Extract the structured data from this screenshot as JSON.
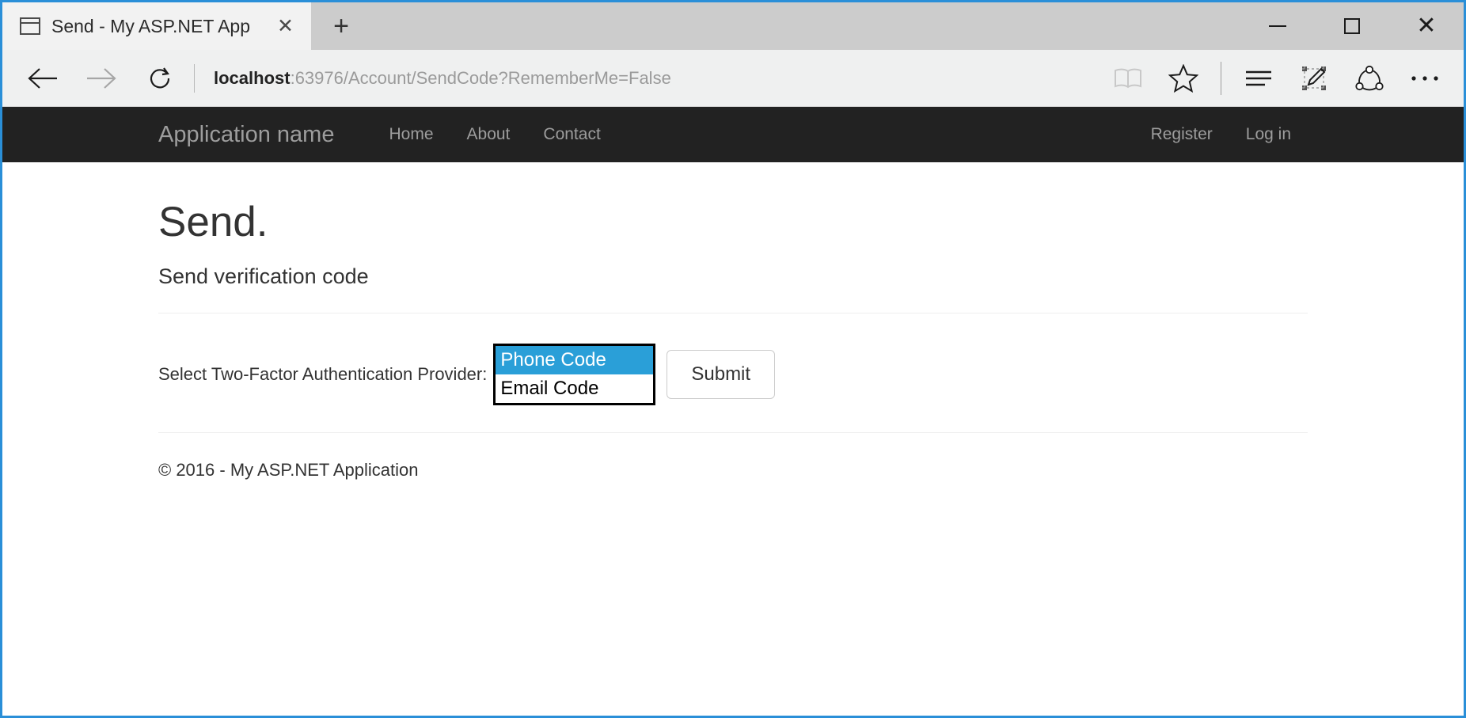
{
  "browser": {
    "tab": {
      "title": "Send - My ASP.NET App",
      "close_label": "✕",
      "favicon": "window-icon"
    },
    "new_tab_label": "+",
    "window_controls": {
      "minimize": "minimize-icon",
      "maximize": "maximize-icon",
      "close": "✕"
    },
    "nav": {
      "back": "back-arrow-icon",
      "forward": "forward-arrow-icon",
      "refresh": "refresh-icon"
    },
    "url": {
      "host": "localhost",
      "rest": ":63976/Account/SendCode?RememberMe=False",
      "full": "localhost:63976/Account/SendCode?RememberMe=False"
    },
    "toolbar_icons": [
      "reading-view-icon",
      "favorites-star-icon",
      "hub-icon",
      "web-note-icon",
      "share-icon",
      "more-icon"
    ]
  },
  "site": {
    "brand": "Application name",
    "nav_left": [
      {
        "label": "Home"
      },
      {
        "label": "About"
      },
      {
        "label": "Contact"
      }
    ],
    "nav_right": [
      {
        "label": "Register"
      },
      {
        "label": "Log in"
      }
    ],
    "navbar_bg": "#222222",
    "navbar_fg": "#9d9d9d"
  },
  "page": {
    "title": "Send.",
    "subtitle": "Send verification code",
    "form": {
      "label": "Select Two-Factor Authentication Provider:",
      "provider_options": [
        {
          "label": "Phone Code",
          "selected": true
        },
        {
          "label": "Email Code",
          "selected": false
        }
      ],
      "selected_value": "Phone Code",
      "submit_label": "Submit",
      "highlight_color": "#2a9fd8"
    },
    "footer": "© 2016 - My ASP.NET Application"
  }
}
